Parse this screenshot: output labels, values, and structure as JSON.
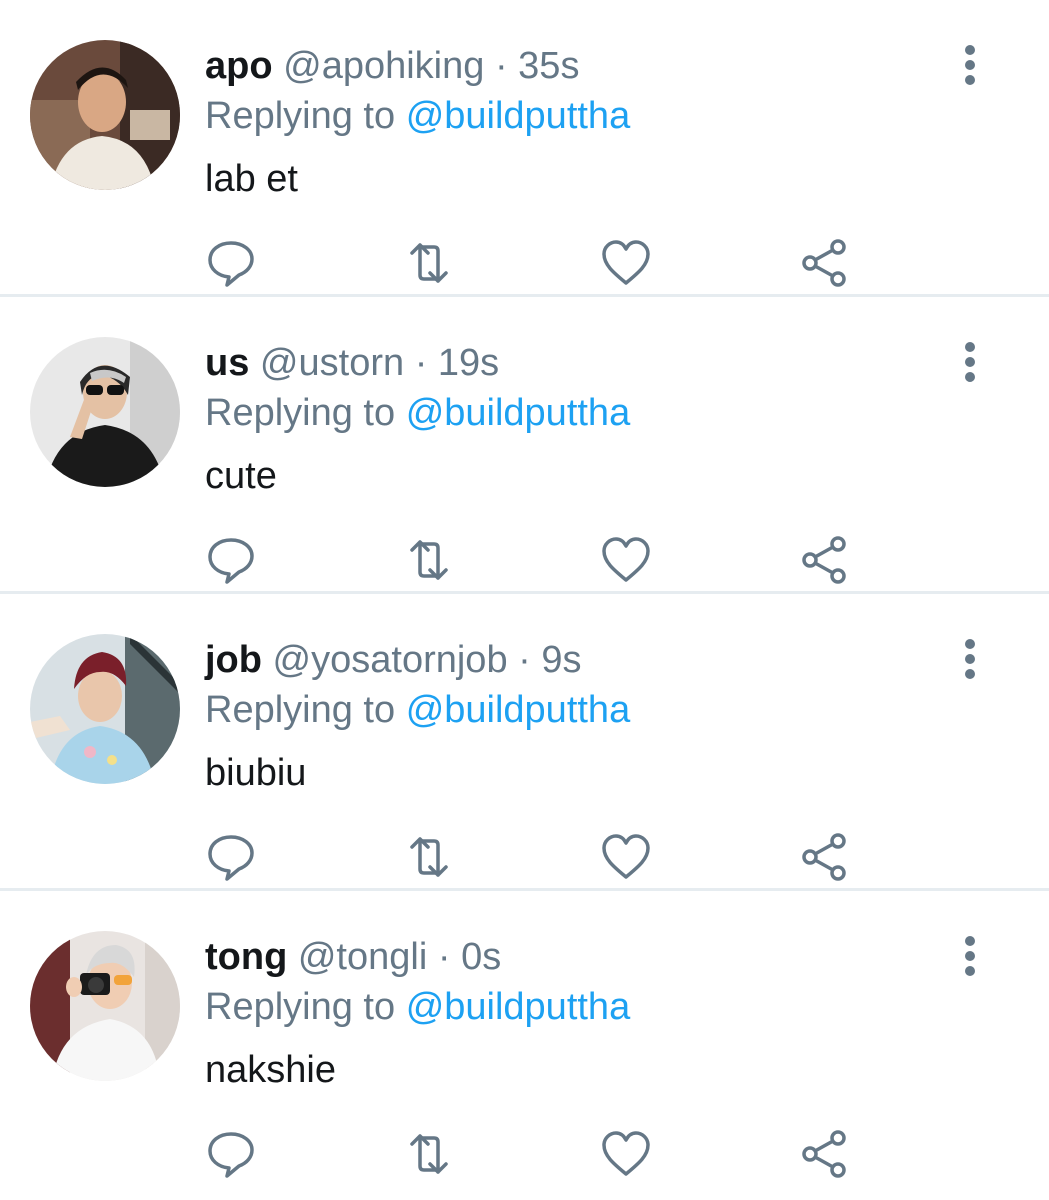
{
  "colors": {
    "name": "#14171a",
    "muted": "#657786",
    "link": "#1da1f2",
    "icon": "#657786",
    "divider": "#e6ecf0"
  },
  "icons": {
    "reply": "speech-bubble",
    "retweet": "retweet-arrows",
    "like": "heart-outline",
    "share": "share-nodes",
    "more": "vertical-ellipsis"
  },
  "tweets": [
    {
      "name": "apo",
      "handle": "@apohiking",
      "separator": "·",
      "time": "35s",
      "replying_prefix": "Replying to",
      "replying_to": "@buildputtha",
      "text": "lab et"
    },
    {
      "name": "us",
      "handle": "@ustorn",
      "separator": "·",
      "time": "19s",
      "replying_prefix": "Replying to",
      "replying_to": "@buildputtha",
      "text": "cute"
    },
    {
      "name": "job",
      "handle": "@yosatornjob",
      "separator": "·",
      "time": "9s",
      "replying_prefix": "Replying to",
      "replying_to": "@buildputtha",
      "text": "biubiu"
    },
    {
      "name": "tong",
      "handle": "@tongli",
      "separator": "·",
      "time": "0s",
      "replying_prefix": "Replying to",
      "replying_to": "@buildputtha",
      "text": "nakshie"
    }
  ]
}
